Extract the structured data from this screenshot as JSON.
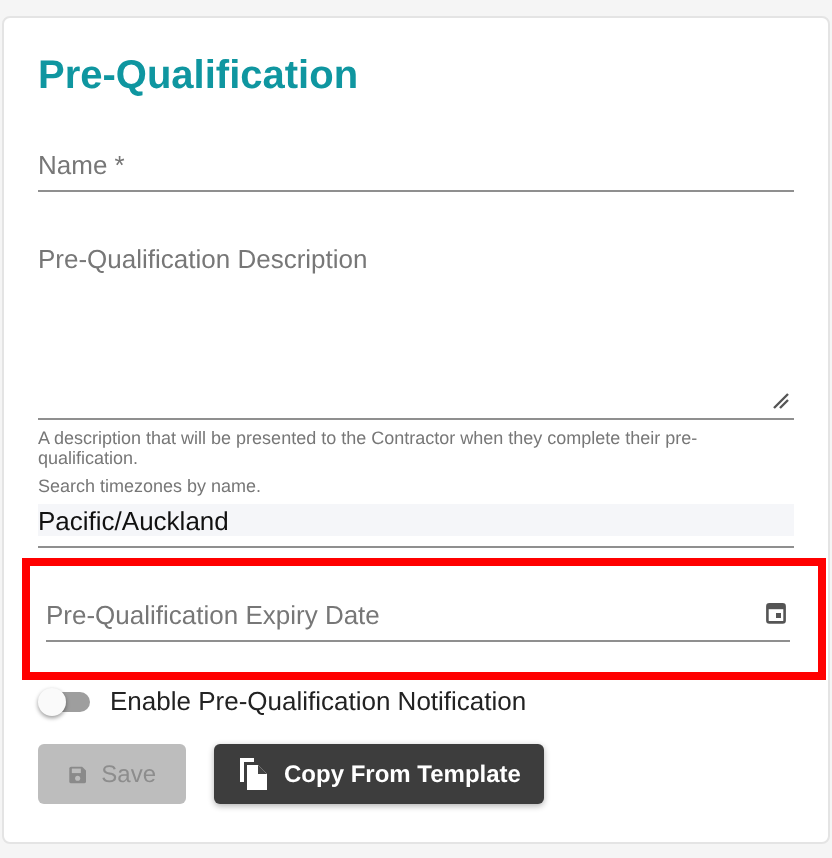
{
  "title": "Pre-Qualification",
  "name_field": {
    "placeholder": "Name *"
  },
  "description_field": {
    "placeholder": "Pre-Qualification Description",
    "hint": "A description that will be presented to the Contractor when they complete their pre-qualification."
  },
  "timezone_field": {
    "hint": "Search timezones by name.",
    "value": "Pacific/Auckland"
  },
  "expiry_field": {
    "placeholder": "Pre-Qualification Expiry Date",
    "highlighted": true
  },
  "notification_toggle": {
    "label": "Enable Pre-Qualification Notification",
    "on": false
  },
  "buttons": [
    {
      "kind": "save",
      "label": "Save",
      "disabled": true
    },
    {
      "kind": "copy",
      "label": "Copy From Template",
      "disabled": false
    }
  ]
}
